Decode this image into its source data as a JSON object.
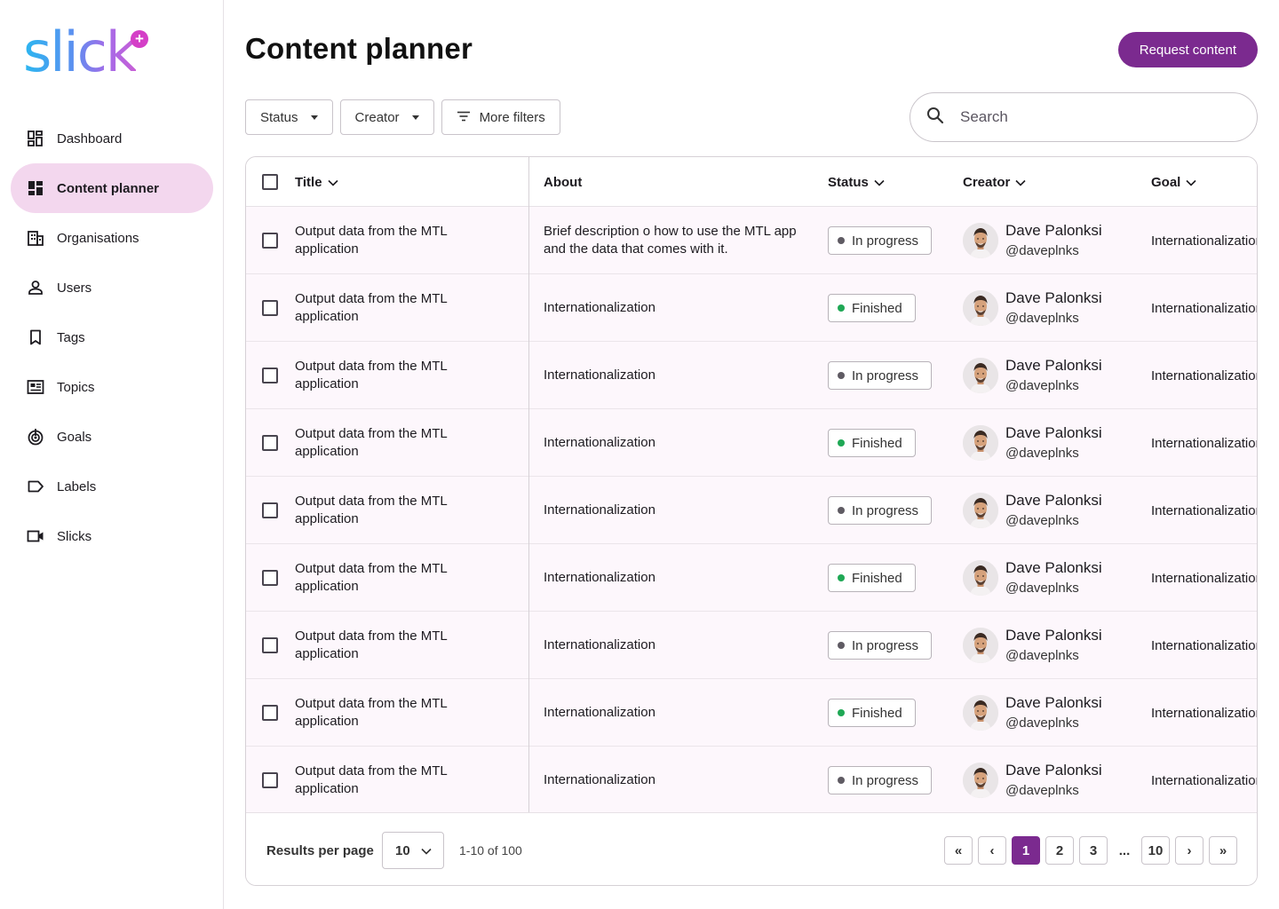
{
  "brand": {
    "logo_text": "slick",
    "logo_plus": "+"
  },
  "sidebar": {
    "items": [
      {
        "label": "Dashboard",
        "icon": "dashboard-icon",
        "active": false
      },
      {
        "label": "Content planner",
        "icon": "content-planner-icon",
        "active": true
      },
      {
        "label": "Organisations",
        "icon": "organisations-icon",
        "active": false
      },
      {
        "label": "Users",
        "icon": "user-icon",
        "active": false
      },
      {
        "label": "Tags",
        "icon": "bookmark-icon",
        "active": false
      },
      {
        "label": "Topics",
        "icon": "topics-icon",
        "active": false
      },
      {
        "label": "Goals",
        "icon": "goal-icon",
        "active": false
      },
      {
        "label": "Labels",
        "icon": "label-icon",
        "active": false
      },
      {
        "label": "Slicks",
        "icon": "video-icon",
        "active": false
      }
    ]
  },
  "header": {
    "title": "Content planner",
    "request_label": "Request content"
  },
  "filters": {
    "status": "Status",
    "creator": "Creator",
    "more": "More filters"
  },
  "search": {
    "placeholder": "Search"
  },
  "table": {
    "columns": {
      "title": "Title",
      "about": "About",
      "status": "Status",
      "creator": "Creator",
      "goal": "Goal"
    },
    "rows": [
      {
        "title": "Output data from the MTL application",
        "about": "Brief description o how to use the MTL app and the data that comes with it.",
        "status": "In progress",
        "creator_name": "Dave Palonksi",
        "creator_handle": "@daveplnks",
        "goal": "Internationalization"
      },
      {
        "title": "Output data from the MTL application",
        "about": "Internationalization",
        "status": "Finished",
        "creator_name": "Dave Palonksi",
        "creator_handle": "@daveplnks",
        "goal": "Internationalization"
      },
      {
        "title": "Output data from the MTL application",
        "about": "Internationalization",
        "status": "In progress",
        "creator_name": "Dave Palonksi",
        "creator_handle": "@daveplnks",
        "goal": "Internationalization"
      },
      {
        "title": "Output data from the MTL application",
        "about": "Internationalization",
        "status": "Finished",
        "creator_name": "Dave Palonksi",
        "creator_handle": "@daveplnks",
        "goal": "Internationalization"
      },
      {
        "title": "Output data from the MTL application",
        "about": "Internationalization",
        "status": "In progress",
        "creator_name": "Dave Palonksi",
        "creator_handle": "@daveplnks",
        "goal": "Internationalization"
      },
      {
        "title": "Output data from the MTL application",
        "about": "Internationalization",
        "status": "Finished",
        "creator_name": "Dave Palonksi",
        "creator_handle": "@daveplnks",
        "goal": "Internationalization"
      },
      {
        "title": "Output data from the MTL application",
        "about": "Internationalization",
        "status": "In progress",
        "creator_name": "Dave Palonksi",
        "creator_handle": "@daveplnks",
        "goal": "Internationalization"
      },
      {
        "title": "Output data from the MTL application",
        "about": "Internationalization",
        "status": "Finished",
        "creator_name": "Dave Palonksi",
        "creator_handle": "@daveplnks",
        "goal": "Internationalization"
      },
      {
        "title": "Output data from the MTL application",
        "about": "Internationalization",
        "status": "In progress",
        "creator_name": "Dave Palonksi",
        "creator_handle": "@daveplnks",
        "goal": "Internationalization"
      }
    ]
  },
  "status_colors": {
    "In progress": "#5f5b63",
    "Finished": "#1fa855"
  },
  "pagination": {
    "results_label": "Results per page",
    "per_page": "10",
    "range": "1-10 of 100",
    "first": "«",
    "prev": "‹",
    "pages": [
      "1",
      "2",
      "3"
    ],
    "ellipsis": "...",
    "last_page": "10",
    "next": "›",
    "last": "»",
    "current": "1"
  },
  "colors": {
    "accent": "#7b2a8f",
    "active_nav": "#f3d7ee"
  }
}
